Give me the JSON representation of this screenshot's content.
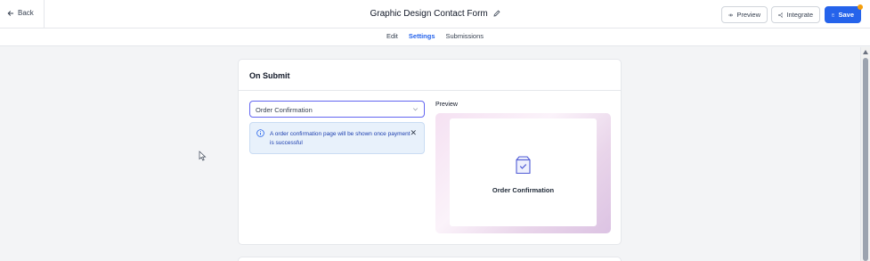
{
  "header": {
    "back_label": "Back",
    "title": "Graphic Design Contact Form",
    "preview_label": "Preview",
    "integrate_label": "Integrate",
    "save_label": "Save"
  },
  "tabs": [
    {
      "label": "Edit",
      "active": false
    },
    {
      "label": "Settings",
      "active": true
    },
    {
      "label": "Submissions",
      "active": false
    }
  ],
  "on_submit": {
    "heading": "On Submit",
    "select_value": "Order Confirmation",
    "alert_message": "A order confirmation page will be shown once payment is successful",
    "preview_label": "Preview",
    "preview_title": "Order Confirmation"
  },
  "colors": {
    "accent": "#2563eb",
    "alert_bg": "#e8f1fb",
    "notification_dot": "#f59e0b"
  }
}
